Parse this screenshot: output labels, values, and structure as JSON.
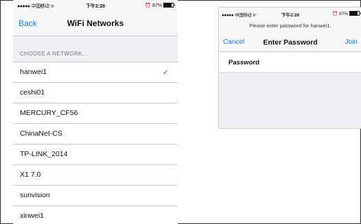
{
  "left_screen": {
    "status": {
      "signal": "●●●●●",
      "carrier": "中国移动",
      "wifi": "ᯤ",
      "time": "下午2:28",
      "alarm": "⏰",
      "battery": "87%"
    },
    "nav": {
      "back": "Back",
      "title": "WiFi Networks"
    },
    "section_header": "CHOOSE A NETWORK...",
    "networks": [
      {
        "name": "hanwei1",
        "selected": true
      },
      {
        "name": "ceshi01"
      },
      {
        "name": "MERCURY_CF56"
      },
      {
        "name": "ChinaNet-CS"
      },
      {
        "name": "TP-LINK_2014"
      },
      {
        "name": "X1 7.0"
      },
      {
        "name": "sunvision"
      },
      {
        "name": "xinwei1"
      }
    ],
    "check_mark": "✓"
  },
  "right_screen": {
    "status": {
      "signal": "●●●●●",
      "carrier": "中国移动",
      "wifi": "ᯤ",
      "time": "下午2:28",
      "alarm": "⏰",
      "battery": "87%"
    },
    "prompt": "Please enter password for hanwei1.",
    "nav": {
      "cancel": "Cancel",
      "title": "Enter Password",
      "join": "Join"
    },
    "password_label": "Password",
    "password_value": ""
  },
  "colors": {
    "accent": "#1a7ed9",
    "grouped_bg": "#efeff4",
    "separator": "#c8c8cc"
  }
}
